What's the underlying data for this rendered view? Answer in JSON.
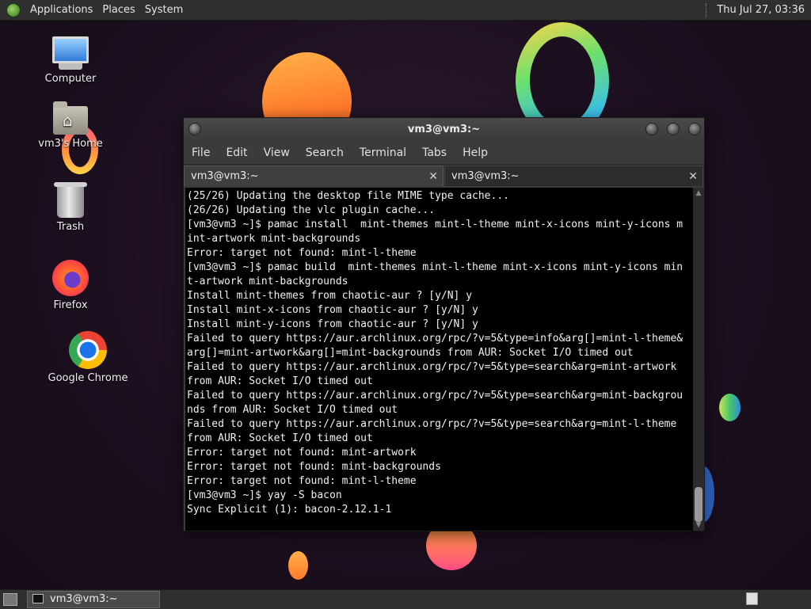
{
  "top_panel": {
    "menus": [
      "Applications",
      "Places",
      "System"
    ],
    "clock": "Thu Jul 27, 03:36"
  },
  "desktop": {
    "icons": [
      {
        "label": "Computer",
        "icon": "computer-icon"
      },
      {
        "label": "vm3's Home",
        "icon": "home-folder-icon"
      },
      {
        "label": "Trash",
        "icon": "trash-icon"
      },
      {
        "label": "Firefox",
        "icon": "firefox-icon"
      },
      {
        "label": "Google Chrome",
        "icon": "chrome-icon"
      }
    ]
  },
  "terminal": {
    "title": "vm3@vm3:~",
    "menu": [
      "File",
      "Edit",
      "View",
      "Search",
      "Terminal",
      "Tabs",
      "Help"
    ],
    "tabs": [
      {
        "label": "vm3@vm3:~",
        "active": true
      },
      {
        "label": "vm3@vm3:~",
        "active": false
      }
    ],
    "lines": [
      "(25/26) Updating the desktop file MIME type cache...",
      "(26/26) Updating the vlc plugin cache...",
      "[vm3@vm3 ~]$ pamac install  mint-themes mint-l-theme mint-x-icons mint-y-icons m",
      "int-artwork mint-backgrounds",
      "Error: target not found: mint-l-theme",
      "[vm3@vm3 ~]$ pamac build  mint-themes mint-l-theme mint-x-icons mint-y-icons min",
      "t-artwork mint-backgrounds",
      "Install mint-themes from chaotic-aur ? [y/N] y",
      "Install mint-x-icons from chaotic-aur ? [y/N] y",
      "Install mint-y-icons from chaotic-aur ? [y/N] y",
      "Failed to query https://aur.archlinux.org/rpc/?v=5&type=info&arg[]=mint-l-theme&",
      "arg[]=mint-artwork&arg[]=mint-backgrounds from AUR: Socket I/O timed out",
      "Failed to query https://aur.archlinux.org/rpc/?v=5&type=search&arg=mint-artwork",
      "from AUR: Socket I/O timed out",
      "Failed to query https://aur.archlinux.org/rpc/?v=5&type=search&arg=mint-backgrou",
      "nds from AUR: Socket I/O timed out",
      "Failed to query https://aur.archlinux.org/rpc/?v=5&type=search&arg=mint-l-theme",
      "from AUR: Socket I/O timed out",
      "Error: target not found: mint-artwork",
      "Error: target not found: mint-backgrounds",
      "Error: target not found: mint-l-theme",
      "[vm3@vm3 ~]$ yay -S bacon",
      "Sync Explicit (1): bacon-2.12.1-1"
    ]
  },
  "taskbar": {
    "tasks": [
      {
        "label": "vm3@vm3:~",
        "icon": "terminal-icon"
      }
    ]
  }
}
